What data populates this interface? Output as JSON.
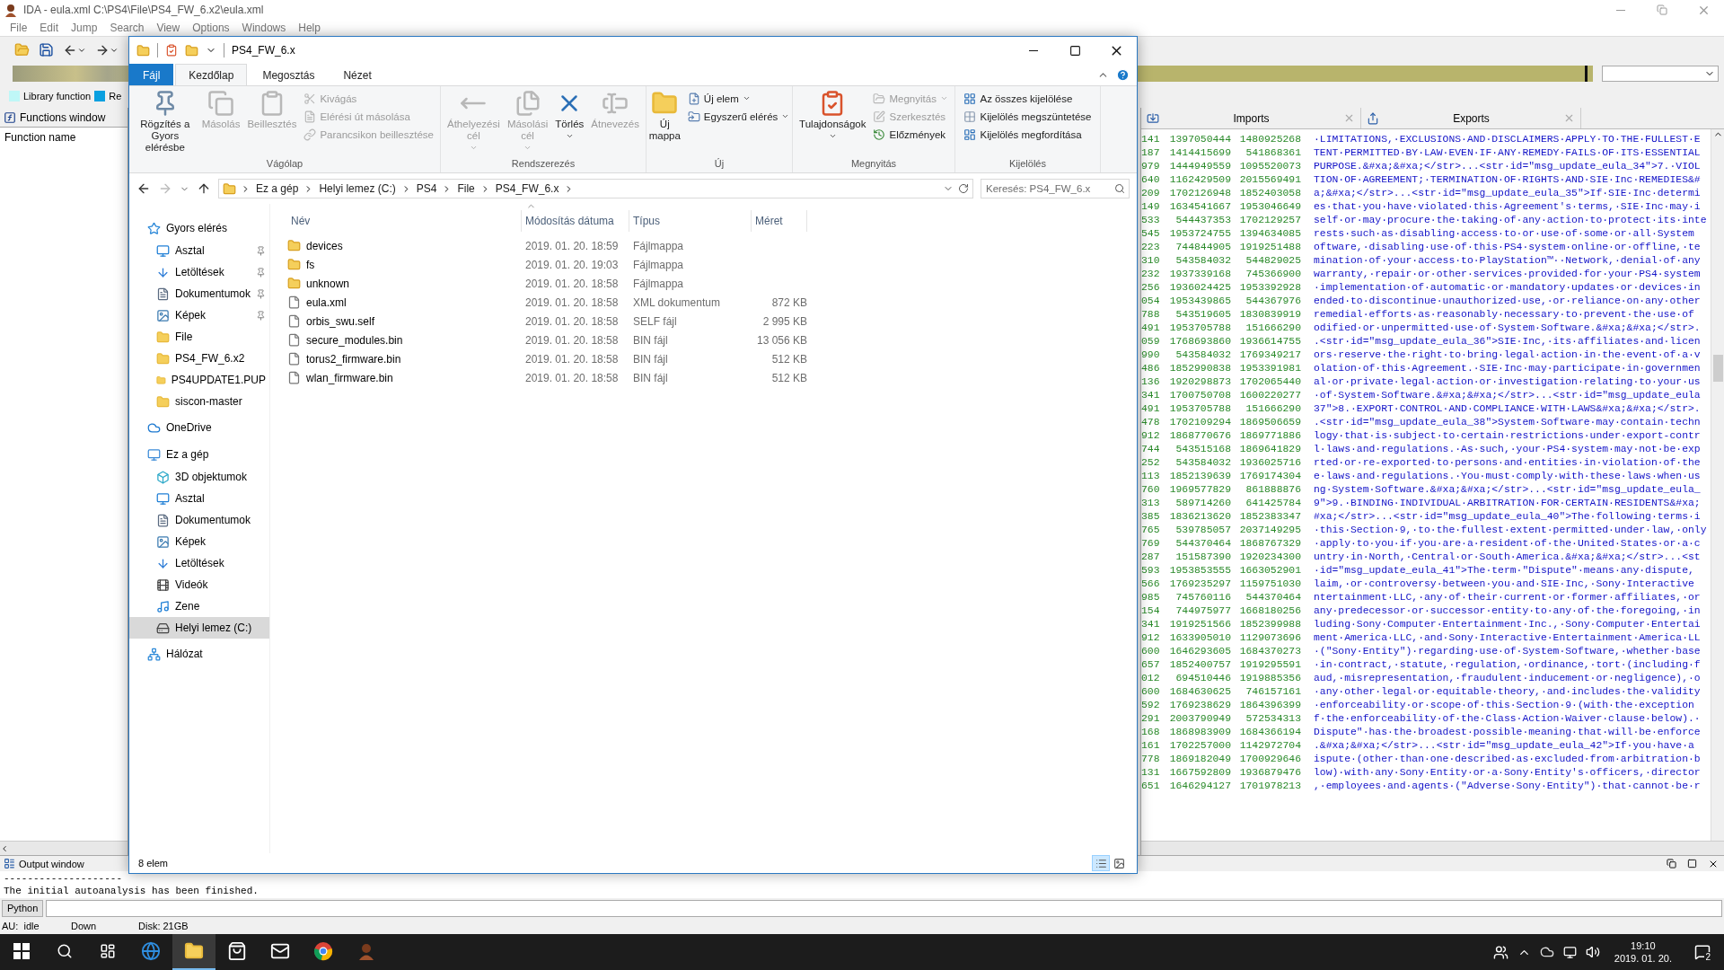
{
  "ida": {
    "title": "IDA - eula.xml C:\\PS4\\File\\PS4_FW_6.x2\\eula.xml",
    "menu": [
      "File",
      "Edit",
      "Jump",
      "Search",
      "View",
      "Options",
      "Windows",
      "Help"
    ],
    "legend": [
      {
        "label": "Library function",
        "color": "#bff7f7"
      },
      {
        "label": "Re",
        "color": "#0aa0e0"
      }
    ],
    "functions_window": {
      "title": "Functions window",
      "column": "Function name"
    },
    "hex_tabs": [
      {
        "label": "Imports"
      },
      {
        "label": "Exports"
      }
    ],
    "hex_rows": [
      [
        "141",
        "1397050444",
        "1480925268",
        "·LIMITATIONS,·EXCLUSIONS·AND·DISCLAIMERS·APPLY·TO·THE·FULLEST·E"
      ],
      [
        "187",
        "1414415699",
        "541868361",
        "TENT·PERMITTED·BY·LAW·EVEN·IF·ANY·REMEDY·FAILS·OF·ITS·ESSENTIAL"
      ],
      [
        "979",
        "1444949559",
        "1095520073",
        "PURPOSE.&#xa;&#xa;</str>...<str·id=\"msg_update_eula_34\">7.·VIOL"
      ],
      [
        "640",
        "1162429509",
        "2015569491",
        "TION·OF·AGREEMENT;·TERMINATION·OF·RIGHTS·AND·SIE·Inc·REMEDIES&#"
      ],
      [
        "209",
        "1702126948",
        "1852403058",
        "a;&#xa;</str>...<str·id=\"msg_update_eula_35\">If·SIE·Inc·determi"
      ],
      [
        "149",
        "1634541667",
        "1953046649",
        "es·that·you·have·violated·this·Agreement's·terms,·SIE·Inc·may·i"
      ],
      [
        "533",
        "544437353",
        "1702129257",
        "self·or·may·procure·the·taking·of·any·action·to·protect·its·inte"
      ],
      [
        "545",
        "1953724755",
        "1394634085",
        "rests·such·as·disabling·access·to·or·use·of·some·or·all·System"
      ],
      [
        "223",
        "744844905",
        "1919251488",
        "oftware,·disabling·use·of·this·PS4·system·online·or·offline,·te"
      ],
      [
        "310",
        "543584032",
        "544829025",
        "mination·of·your·access·to·PlayStation™··Network,·denial·of·any"
      ],
      [
        "232",
        "1937339168",
        "745366900",
        "warranty,·repair·or·other·services·provided·for·your·PS4·system"
      ],
      [
        "256",
        "1936024425",
        "1953392928",
        "·implementation·of·automatic·or·mandatory·updates·or·devices·in"
      ],
      [
        "054",
        "1953439865",
        "544367976",
        "ended·to·discontinue·unauthorized·use,·or·reliance·on·any·other"
      ],
      [
        "788",
        "543519605",
        "1830839919",
        "remedial·efforts·as·reasonably·necessary·to·prevent·the·use·of"
      ],
      [
        "491",
        "1953705788",
        "151666290",
        "odified·or·unpermitted·use·of·System·Software.&#xa;&#xa;</str>."
      ],
      [
        "059",
        "1768693860",
        "1936614755",
        ".<str·id=\"msg_update_eula_36\">SIE·Inc,·its·affiliates·and·licen"
      ],
      [
        "990",
        "543584032",
        "1769349217",
        "ors·reserve·the·right·to·bring·legal·action·in·the·event·of·a·v"
      ],
      [
        "486",
        "1852990838",
        "1953391981",
        "olation·of·this·Agreement.·SIE·Inc·may·participate·in·governmen"
      ],
      [
        "136",
        "1920298873",
        "1702065440",
        "al·or·private·legal·action·or·investigation·relating·to·your·us"
      ],
      [
        "341",
        "1700750708",
        "1600220277",
        "·of·System·Software.&#xa;&#xa;</str>...<str·id=\"msg_update_eula"
      ],
      [
        "491",
        "1953705788",
        "151666290",
        "37\">8.·EXPORT·CONTROL·AND·COMPLIANCE·WITH·LAWS&#xa;&#xa;</str>."
      ],
      [
        "478",
        "1702109294",
        "1869506659",
        ".<str·id=\"msg_update_eula_38\">System·Software·may·contain·techn"
      ],
      [
        "912",
        "1868770676",
        "1869771886",
        "logy·that·is·subject·to·certain·restrictions·under·export-contr"
      ],
      [
        "744",
        "543515168",
        "1869641829",
        "l·laws·and·regulations.·As·such,·your·PS4·system·may·not·be·exp"
      ],
      [
        "252",
        "543584032",
        "1936025716",
        "rted·or·re-exported·to·persons·and·entities·in·violation·of·the"
      ],
      [
        "113",
        "1852139639",
        "1769174304",
        "e·laws·and·regulations.·You·must·comply·with·these·laws·when·us"
      ],
      [
        "760",
        "1969577829",
        "861888876",
        "ng·System·Software.&#xa;&#xa;</str>...<str·id=\"msg_update_eula_"
      ],
      [
        "313",
        "589714260",
        "641425784",
        "9\">9.·BINDING·INDIVIDUAL·ARBITRATION·FOR·CERTAIN·RESIDENTS&#xa;"
      ],
      [
        "385",
        "1836213620",
        "1852383347",
        "#xa;</str>...<str·id=\"msg_update_eula_40\">The·following·terms·i"
      ],
      [
        "765",
        "539785057",
        "2037149295",
        "·this·Section·9,·to·the·fullest·extent·permitted·under·law,·only"
      ],
      [
        "769",
        "544370464",
        "1868767329",
        "·apply·to·you·if·you·are·a·resident·of·the·United·States·or·a·c"
      ],
      [
        "287",
        "151587390",
        "1920234300",
        "untry·in·North,·Central·or·South·America.&#xa;&#xa;</str>...<st"
      ],
      [
        "593",
        "1953853555",
        "1663052901",
        "·id=\"msg_update_eula_41\">The·term·\"Dispute\"·means·any·dispute,"
      ],
      [
        "566",
        "1769235297",
        "1159751030",
        "laim,·or·controversy·between·you·and·SIE·Inc,·Sony·Interactive"
      ],
      [
        "985",
        "745760116",
        "544370464",
        "ntertainment·LLC,·any·of·their·current·or·former·affiliates,·or"
      ],
      [
        "154",
        "744975977",
        "1668180256",
        "any·predecessor·or·successor·entity·to·any·of·the·foregoing,·in"
      ],
      [
        "341",
        "1919251566",
        "1852399988",
        "luding·Sony·Computer·Entertainment·Inc.,·Sony·Computer·Entertai"
      ],
      [
        "912",
        "1633905010",
        "1129073696",
        "ment·America·LLC,·and·Sony·Interactive·Entertainment·America·LL"
      ],
      [
        "600",
        "1646293605",
        "1684370273",
        "·(\"Sony·Entity\")·regarding·use·of·System·Software,·whether·base"
      ],
      [
        "657",
        "1852400757",
        "1919295591",
        "·in·contract,·statute,·regulation,·ordinance,·tort·(including·f"
      ],
      [
        "012",
        "694510446",
        "1919885356",
        "aud,·misrepresentation,·fraudulent·inducement·or·negligence),·o"
      ],
      [
        "600",
        "1684630625",
        "746157161",
        "·any·other·legal·or·equitable·theory,·and·includes·the·validity"
      ],
      [
        "592",
        "1769238629",
        "1864396399",
        "·enforceability·or·scope·of·this·Section·9·(with·the·exception"
      ],
      [
        "291",
        "2003790949",
        "572534313",
        "f·the·enforceability·of·the·Class·Action·Waiver·clause·below).·"
      ],
      [
        "168",
        "1868983909",
        "1684366194",
        "Dispute\"·has·the·broadest·possible·meaning·that·will·be·enforce"
      ],
      [
        "161",
        "1702257000",
        "1142972704",
        ".&#xa;&#xa;</str>...<str·id=\"msg_update_eula_42\">If·you·have·a"
      ],
      [
        "778",
        "1869182049",
        "1700929646",
        "ispute·(other·than·one·described·as·excluded·from·arbitration·b"
      ],
      [
        "131",
        "1667592809",
        "1936879476",
        "low)·with·any·Sony·Entity·or·a·Sony·Entity's·officers,·director"
      ],
      [
        "651",
        "1646294127",
        "1701978213",
        ",·employees·and·agents·(\"Adverse·Sony·Entity\")·that·cannot·be·r"
      ]
    ],
    "output_window": {
      "title": "Output window",
      "lines": [
        "--------------------",
        "The initial autoanalysis has been finished."
      ]
    },
    "python_button": "Python",
    "status": [
      "AU:  idle",
      "Down",
      "Disk: 21GB"
    ]
  },
  "explorer": {
    "title": "PS4_FW_6.x",
    "ribbon_tabs": [
      {
        "label": "Fájl",
        "kind": "file",
        "selected": false
      },
      {
        "label": "Kezdőlap",
        "kind": "tab",
        "selected": true
      },
      {
        "label": "Megosztás",
        "kind": "tab",
        "selected": false
      },
      {
        "label": "Nézet",
        "kind": "tab",
        "selected": false
      }
    ],
    "groups": [
      {
        "label": "Vágólap",
        "large": [
          {
            "label": "Rögzítés a Gyors elérésbe",
            "kind": "pin",
            "disabled": false,
            "dropdown": false
          },
          {
            "label": "Másolás",
            "kind": "copy",
            "disabled": true,
            "dropdown": false
          },
          {
            "label": "Beillesztés",
            "kind": "paste",
            "disabled": true,
            "dropdown": false
          }
        ],
        "small": [
          {
            "label": "Kivágás",
            "kind": "cut",
            "disabled": true,
            "dropdown": false
          },
          {
            "label": "Elérési út másolása",
            "kind": "path",
            "disabled": true,
            "dropdown": false
          },
          {
            "label": "Parancsikon beillesztése",
            "kind": "shortcut",
            "disabled": true,
            "dropdown": false
          }
        ]
      },
      {
        "label": "Rendszerezés",
        "large": [
          {
            "label": "Áthelyezési cél",
            "kind": "move",
            "disabled": true,
            "dropdown": true
          },
          {
            "label": "Másolási cél",
            "kind": "copyto",
            "disabled": true,
            "dropdown": true
          },
          {
            "label": "Törlés",
            "kind": "delete",
            "disabled": false,
            "dropdown": true
          },
          {
            "label": "Átnevezés",
            "kind": "rename",
            "disabled": true,
            "dropdown": false
          }
        ]
      },
      {
        "label": "Új",
        "large": [
          {
            "label": "Új mappa",
            "kind": "newfolder",
            "disabled": false,
            "dropdown": false
          }
        ],
        "small": [
          {
            "label": "Új elem",
            "kind": "newitem",
            "disabled": false,
            "dropdown": true
          },
          {
            "label": "Egyszerű elérés",
            "kind": "easyaccess",
            "disabled": false,
            "dropdown": true
          }
        ]
      },
      {
        "label": "Megnyitás",
        "large": [
          {
            "label": "Tulajdonságok",
            "kind": "properties",
            "disabled": false,
            "dropdown": true
          }
        ],
        "small": [
          {
            "label": "Megnyitás",
            "kind": "open",
            "disabled": true,
            "dropdown": true
          },
          {
            "label": "Szerkesztés",
            "kind": "edit",
            "disabled": true,
            "dropdown": false
          },
          {
            "label": "Előzmények",
            "kind": "history",
            "disabled": false,
            "dropdown": false
          }
        ]
      },
      {
        "label": "Kijelölés",
        "small": [
          {
            "label": "Az összes kijelölése",
            "kind": "selectall",
            "disabled": false,
            "dropdown": false
          },
          {
            "label": "Kijelölés megszüntetése",
            "kind": "selectnone",
            "disabled": false,
            "dropdown": false
          },
          {
            "label": "Kijelölés megfordítása",
            "kind": "invert",
            "disabled": false,
            "dropdown": false
          }
        ]
      }
    ],
    "crumbs": [
      "Ez a gép",
      "Helyi lemez (C:)",
      "PS4",
      "File",
      "PS4_FW_6.x"
    ],
    "search": {
      "placeholder": "Keresés: PS4_FW_6.x"
    },
    "nav": [
      {
        "label": "Gyors elérés",
        "kind": "star",
        "selected": false,
        "children": [
          {
            "label": "Asztal",
            "kind": "desktop",
            "pinned": true,
            "selected": false
          },
          {
            "label": "Letöltések",
            "kind": "download",
            "pinned": true,
            "selected": false
          },
          {
            "label": "Dokumentumok",
            "kind": "documents",
            "pinned": true,
            "selected": false
          },
          {
            "label": "Képek",
            "kind": "pictures",
            "pinned": true,
            "selected": false
          },
          {
            "label": "File",
            "kind": "folder",
            "pinned": false,
            "selected": false
          },
          {
            "label": "PS4_FW_6.x2",
            "kind": "folder",
            "pinned": false,
            "selected": false
          },
          {
            "label": "PS4UPDATE1.PUP",
            "kind": "folder",
            "pinned": false,
            "selected": false
          },
          {
            "label": "siscon-master",
            "kind": "folder",
            "pinned": false,
            "selected": false
          }
        ]
      },
      {
        "label": "OneDrive",
        "kind": "cloud",
        "selected": false
      },
      {
        "label": "Ez a gép",
        "kind": "computer",
        "selected": false,
        "children": [
          {
            "label": "3D objektumok",
            "kind": "cube",
            "selected": false
          },
          {
            "label": "Asztal",
            "kind": "desktop",
            "selected": false
          },
          {
            "label": "Dokumentumok",
            "kind": "documents",
            "selected": false
          },
          {
            "label": "Képek",
            "kind": "pictures",
            "selected": false
          },
          {
            "label": "Letöltések",
            "kind": "download",
            "selected": false
          },
          {
            "label": "Videók",
            "kind": "video",
            "selected": false
          },
          {
            "label": "Zene",
            "kind": "music",
            "selected": false
          },
          {
            "label": "Helyi lemez (C:)",
            "kind": "drive",
            "selected": true
          }
        ]
      },
      {
        "label": "Hálózat",
        "kind": "network",
        "selected": false
      }
    ],
    "columns": [
      "Név",
      "Módosítás dátuma",
      "Típus",
      "Méret"
    ],
    "files": [
      {
        "kind": "folder",
        "name": "devices",
        "date": "2019. 01. 20. 18:59",
        "type": "Fájlmappa"
      },
      {
        "kind": "folder",
        "name": "fs",
        "date": "2019. 01. 20. 19:03",
        "type": "Fájlmappa"
      },
      {
        "kind": "folder",
        "name": "unknown",
        "date": "2019. 01. 20. 18:58",
        "type": "Fájlmappa"
      },
      {
        "kind": "file",
        "name": "eula.xml",
        "date": "2019. 01. 20. 18:58",
        "type": "XML dokumentum",
        "size": "872 KB"
      },
      {
        "kind": "file",
        "name": "orbis_swu.self",
        "date": "2019. 01. 20. 18:58",
        "type": "SELF fájl",
        "size": "2 995 KB"
      },
      {
        "kind": "file",
        "name": "secure_modules.bin",
        "date": "2019. 01. 20. 18:58",
        "type": "BIN fájl",
        "size": "13 056 KB"
      },
      {
        "kind": "file",
        "name": "torus2_firmware.bin",
        "date": "2019. 01. 20. 18:58",
        "type": "BIN fájl",
        "size": "512 KB"
      },
      {
        "kind": "file",
        "name": "wlan_firmware.bin",
        "date": "2019. 01. 20. 18:58",
        "type": "BIN fájl",
        "size": "512 KB"
      }
    ],
    "status": "8 elem",
    "views": [
      {
        "kind": "details",
        "selected": true
      },
      {
        "kind": "tiles",
        "selected": false
      }
    ]
  },
  "taskbar": {
    "apps": [
      {
        "kind": "edge",
        "active": false
      },
      {
        "kind": "explorer",
        "active": true
      },
      {
        "kind": "store",
        "active": false
      },
      {
        "kind": "mail",
        "active": false
      },
      {
        "kind": "chrome",
        "active": false
      },
      {
        "kind": "ida",
        "active": false
      }
    ],
    "time": "19:10",
    "date": "2019. 01. 20.",
    "notifications": "2"
  }
}
